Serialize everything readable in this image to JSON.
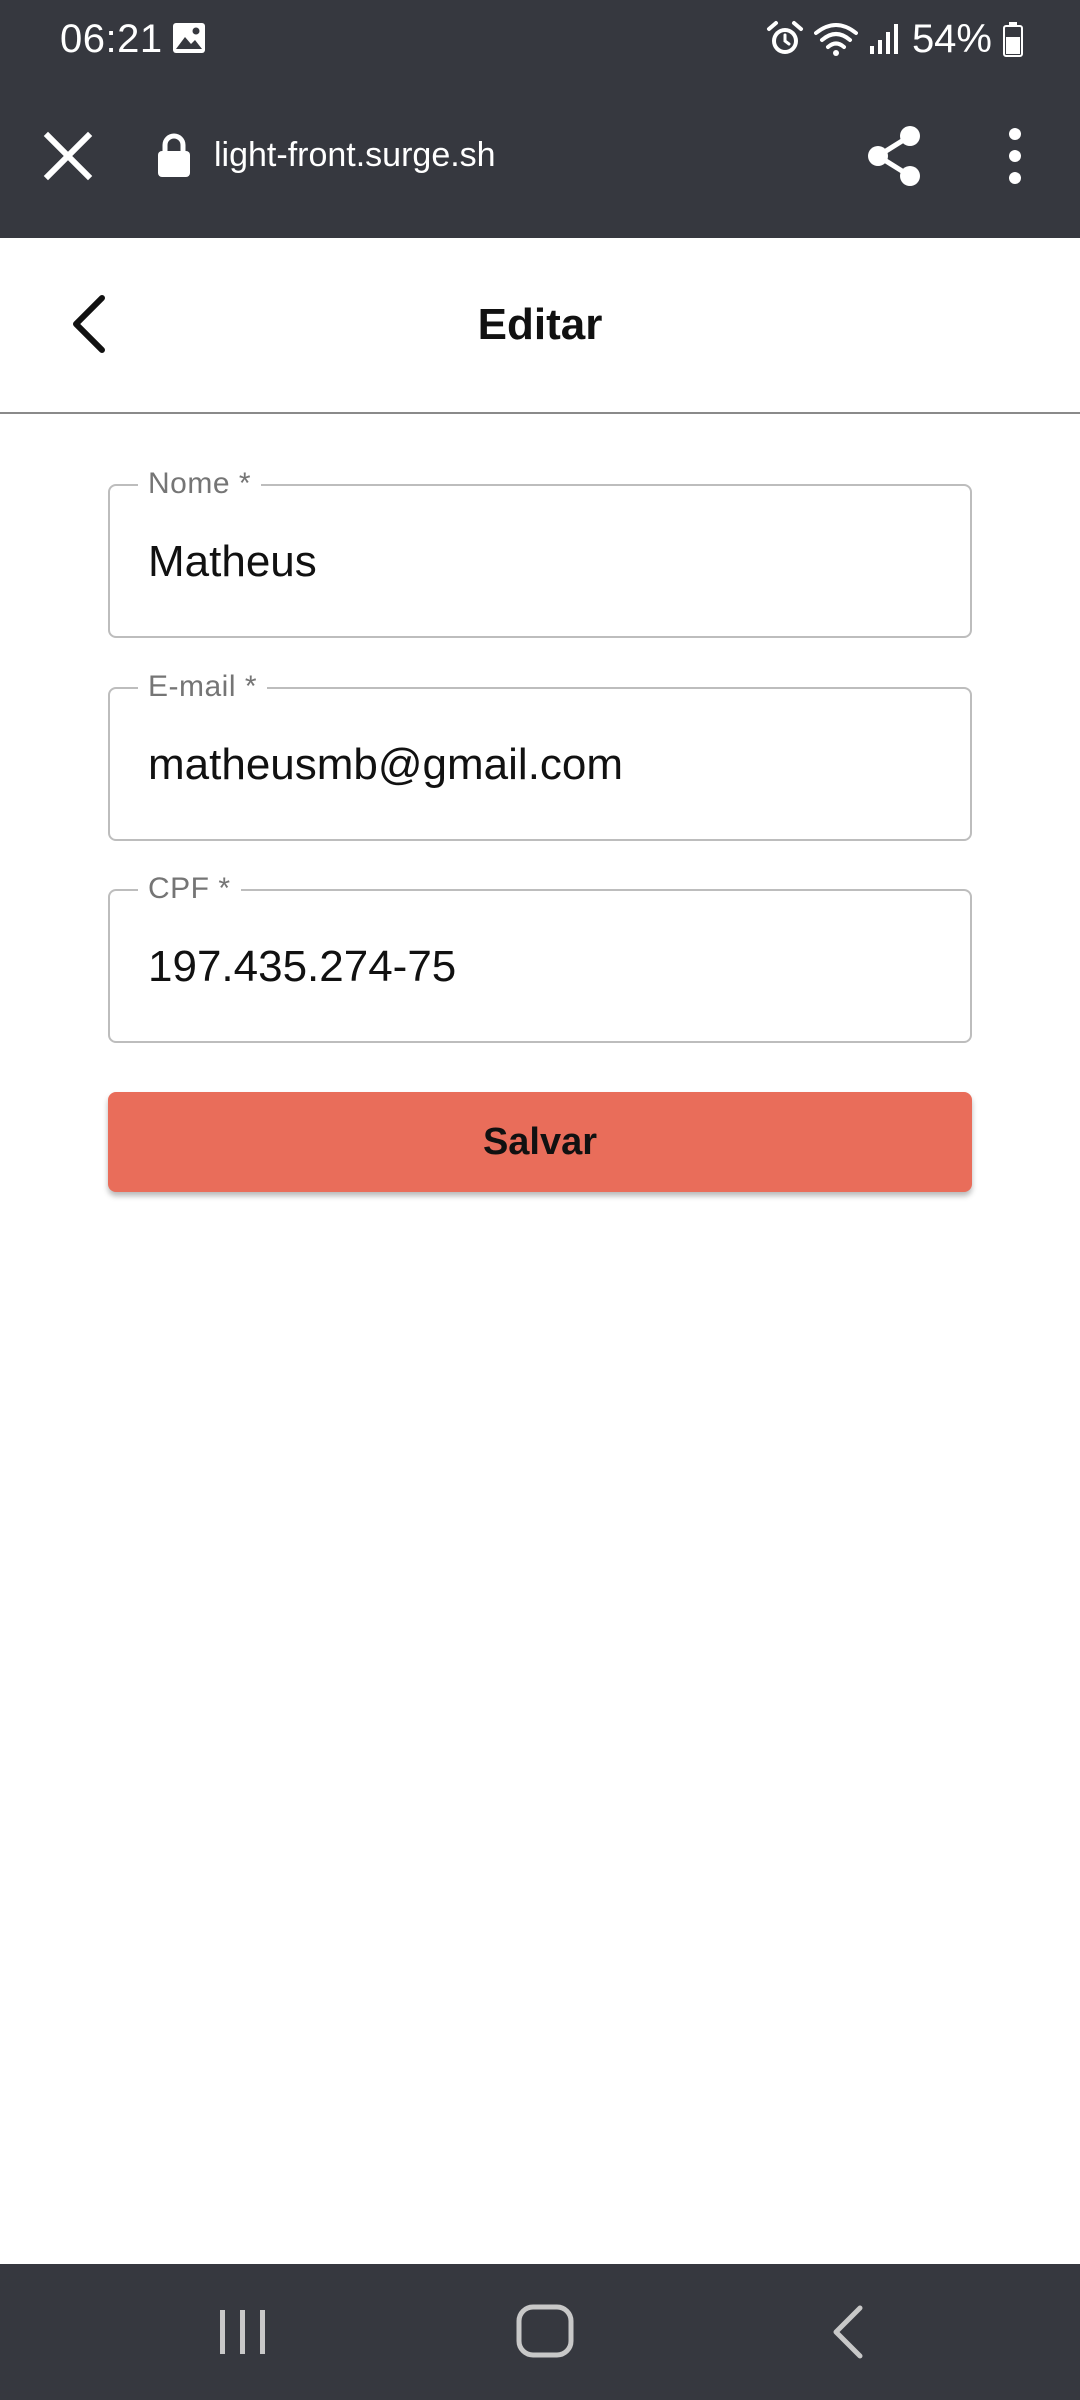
{
  "status_bar": {
    "time": "06:21",
    "battery": "54%",
    "icons": [
      "gallery-icon",
      "alarm-icon",
      "wifi-icon",
      "signal-icon",
      "battery-icon"
    ]
  },
  "browser": {
    "url": "light-front.surge.sh",
    "icons": [
      "close-icon",
      "lock-icon",
      "share-icon",
      "more-vert-icon"
    ]
  },
  "header": {
    "title": "Editar",
    "back_icon": "chevron-left-icon"
  },
  "form": {
    "fields": [
      {
        "label": "Nome *",
        "value": "Matheus"
      },
      {
        "label": "E-mail *",
        "value": "matheusmb@gmail.com"
      },
      {
        "label": "CPF *",
        "value": "197.435.274-75"
      }
    ],
    "save_label": "Salvar",
    "save_color": "#e96d5a"
  },
  "nav_bar": {
    "icons": [
      "recents-icon",
      "home-icon",
      "back-icon"
    ]
  },
  "colors": {
    "system_bar": "#36383f",
    "background": "#ffffff"
  }
}
